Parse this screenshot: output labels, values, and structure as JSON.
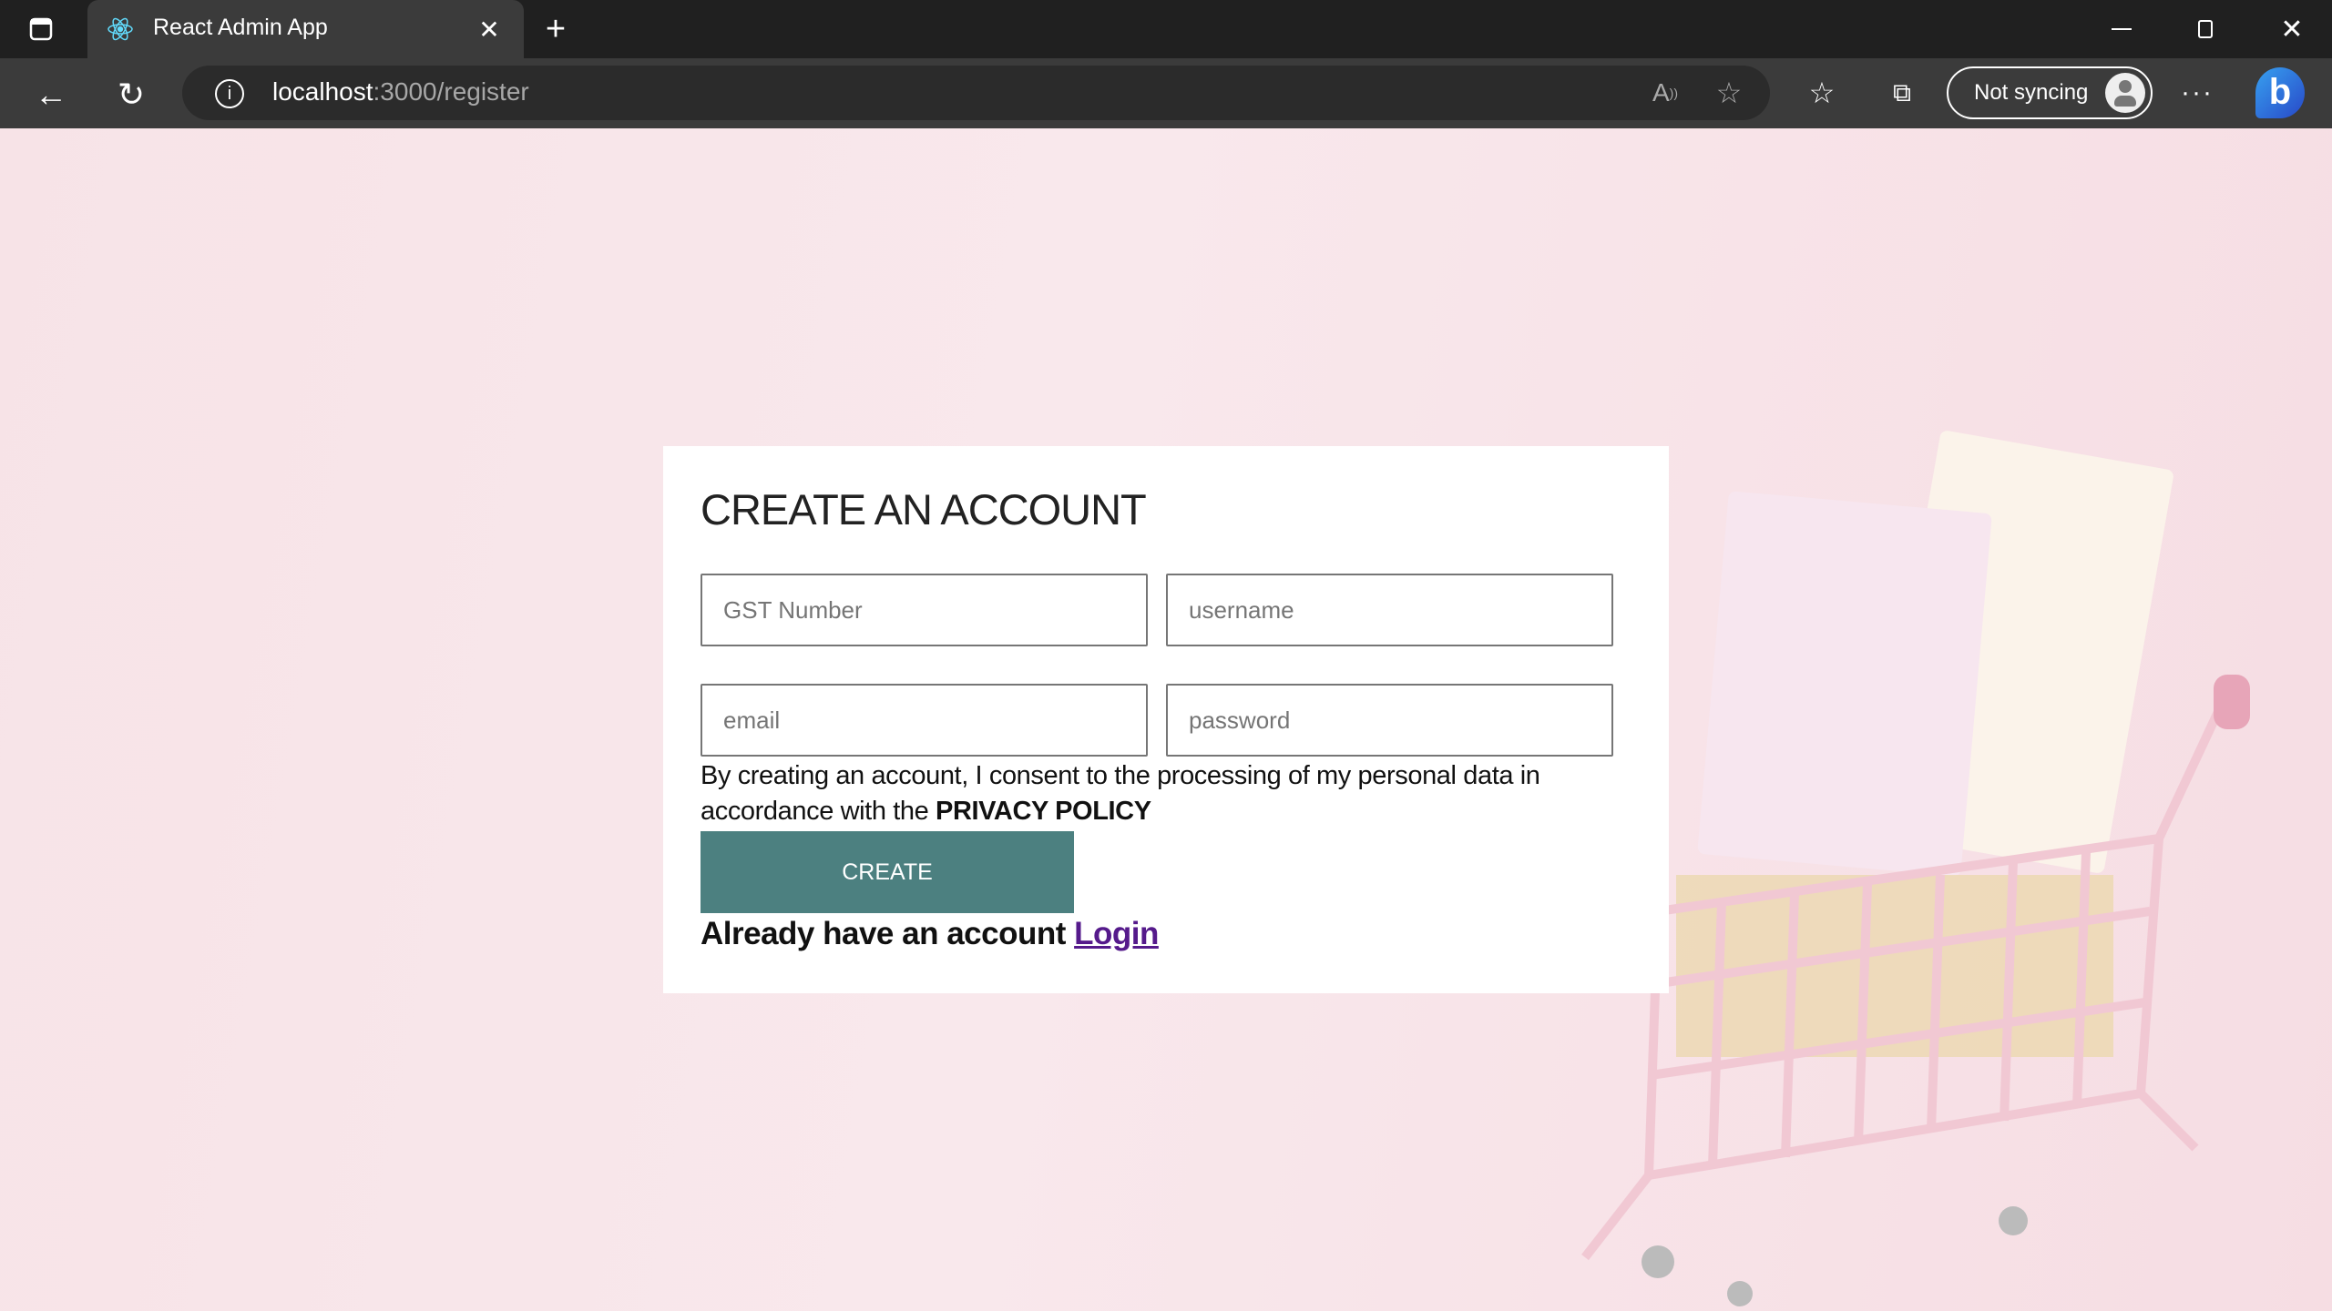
{
  "browser": {
    "tab_title": "React Admin App",
    "url_host": "localhost",
    "url_path": ":3000/register",
    "sync_label": "Not syncing"
  },
  "form": {
    "title": "CREATE AN ACCOUNT",
    "fields": {
      "gst_placeholder": "GST Number",
      "username_placeholder": "username",
      "email_placeholder": "email",
      "password_placeholder": "password"
    },
    "consent_text": "By creating an account, I consent to the processing of my personal data in accordance with the ",
    "privacy_policy": "PRIVACY POLICY",
    "create_label": "CREATE",
    "login_prompt": "Already have an account ",
    "login_link": "Login"
  },
  "colors": {
    "accent": "#4c8080",
    "link": "#551a8b",
    "background": "#f8e4e8"
  }
}
